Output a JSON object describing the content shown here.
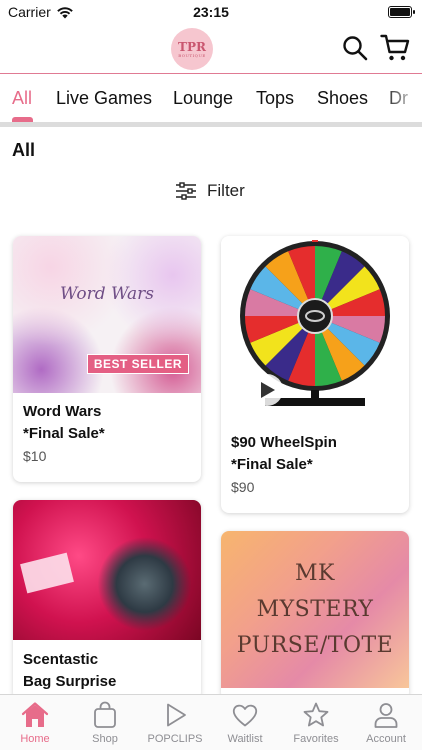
{
  "status_bar": {
    "carrier": "Carrier",
    "time": "23:15"
  },
  "header": {
    "logo_text": "TPR",
    "logo_subtext": "BOUTIQUE"
  },
  "tabs": [
    {
      "label": "All",
      "active": true
    },
    {
      "label": "Live Games",
      "active": false
    },
    {
      "label": "Lounge",
      "active": false
    },
    {
      "label": "Tops",
      "active": false
    },
    {
      "label": "Shoes",
      "active": false
    },
    {
      "label": "Dr",
      "active": false
    }
  ],
  "section_title": "All",
  "filter_label": "Filter",
  "products": [
    {
      "name": "Word Wars\n*Final Sale*",
      "price": "$10",
      "image_text": "Word Wars",
      "badge": "BEST SELLER"
    },
    {
      "name": "$90 WheelSpin\n*Final Sale*",
      "price": "$90"
    },
    {
      "name": "Scentastic\nBag Surprise",
      "price": ""
    },
    {
      "name": "",
      "price": "",
      "image_lines": [
        "MK",
        "MYSTERY",
        "PURSE/TOTE"
      ]
    }
  ],
  "bottom_nav": [
    {
      "label": "Home",
      "icon": "home-icon",
      "active": true
    },
    {
      "label": "Shop",
      "icon": "shopping-bag-icon",
      "active": false
    },
    {
      "label": "POPCLIPS",
      "icon": "play-icon",
      "active": false
    },
    {
      "label": "Waitlist",
      "icon": "heart-icon",
      "active": false
    },
    {
      "label": "Favorites",
      "icon": "star-icon",
      "active": false
    },
    {
      "label": "Account",
      "icon": "person-icon",
      "active": false
    }
  ],
  "colors": {
    "accent": "#e76c8a",
    "inactive": "#8e8e93",
    "logo_bg": "#f6c6cf"
  }
}
